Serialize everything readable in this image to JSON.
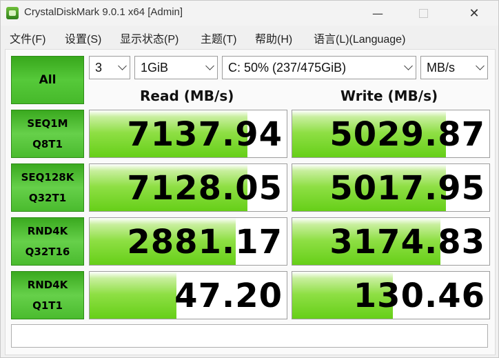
{
  "window": {
    "title": "CrystalDiskMark 9.0.1 x64 [Admin]"
  },
  "menu": [
    "文件(F)",
    "设置(S)",
    "显示状态(P)",
    "主题(T)",
    "帮助(H)",
    "语言(L)(Language)"
  ],
  "controls": {
    "all_label": "All",
    "count": "3",
    "size": "1GiB",
    "drive": "C: 50% (237/475GiB)",
    "unit": "MB/s"
  },
  "headers": {
    "read": "Read (MB/s)",
    "write": "Write (MB/s)"
  },
  "tests": [
    {
      "line1": "SEQ1M",
      "line2": "Q8T1",
      "read": "7137.94",
      "write": "5029.87",
      "read_fill": 0.8,
      "write_fill": 0.78
    },
    {
      "line1": "SEQ128K",
      "line2": "Q32T1",
      "read": "7128.05",
      "write": "5017.95",
      "read_fill": 0.8,
      "write_fill": 0.78
    },
    {
      "line1": "RND4K",
      "line2": "Q32T16",
      "read": "2881.17",
      "write": "3174.83",
      "read_fill": 0.74,
      "write_fill": 0.75
    },
    {
      "line1": "RND4K",
      "line2": "Q1T1",
      "read": "47.20",
      "write": "130.46",
      "read_fill": 0.44,
      "write_fill": 0.51
    }
  ],
  "status": {
    "text": ""
  }
}
